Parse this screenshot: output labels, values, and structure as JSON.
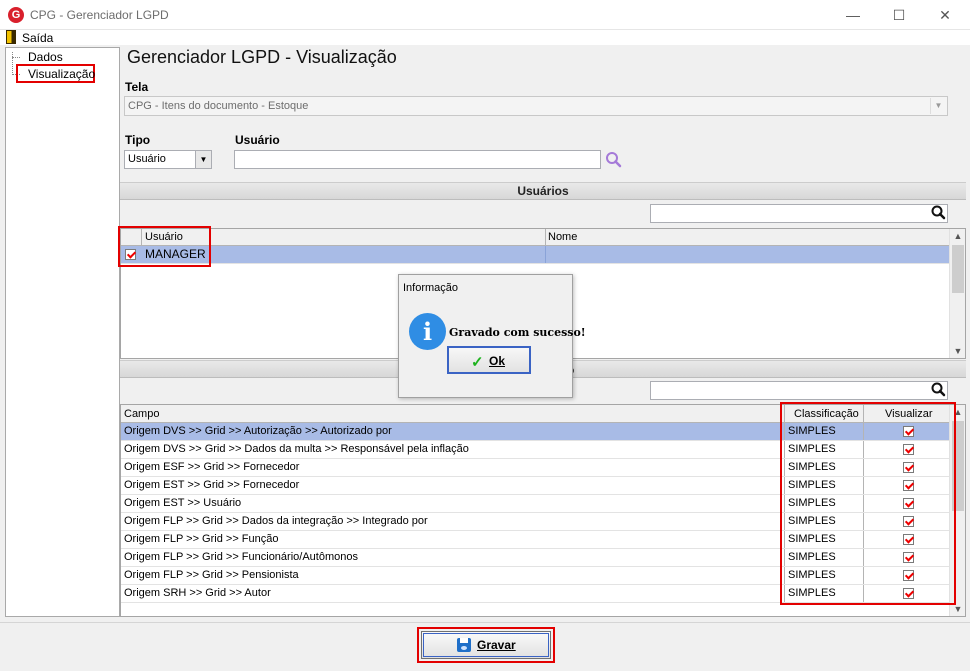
{
  "window": {
    "title": "CPG - Gerenciador LGPD",
    "logo_letter": "G",
    "minimize_glyph": "—",
    "maximize_glyph": "☐",
    "close_glyph": "✕"
  },
  "menu": {
    "exit_label": "Saída"
  },
  "tree": {
    "items": [
      {
        "label": "Dados"
      },
      {
        "label": "Visualização"
      }
    ]
  },
  "header": {
    "title": "Gerenciador LGPD - Visualização"
  },
  "form": {
    "screen_label": "Tela",
    "screen_value": "CPG - Itens do documento - Estoque",
    "type_label": "Tipo",
    "type_value": "Usuário",
    "user_label": "Usuário",
    "user_value": ""
  },
  "users_section": {
    "title": "Usuários",
    "search_value": "",
    "columns": [
      "Usuário",
      "Nome"
    ],
    "rows": [
      {
        "user": "MANAGER",
        "name": "",
        "checked": true
      }
    ]
  },
  "fields_section": {
    "title_suffix": "o",
    "search_value": "",
    "columns": [
      "Campo",
      "Classificação",
      "Visualizar"
    ],
    "rows": [
      {
        "field": "Origem DVS >> Grid >> Autorização >> Autorizado por",
        "classification": "SIMPLES",
        "visible": true
      },
      {
        "field": "Origem DVS >> Grid >> Dados da multa >> Responsável pela inflação",
        "classification": "SIMPLES",
        "visible": true
      },
      {
        "field": "Origem ESF >> Grid >> Fornecedor",
        "classification": "SIMPLES",
        "visible": true
      },
      {
        "field": "Origem EST >> Grid >> Fornecedor",
        "classification": "SIMPLES",
        "visible": true
      },
      {
        "field": "Origem EST >> Usuário",
        "classification": "SIMPLES",
        "visible": true
      },
      {
        "field": "Origem FLP >> Grid >> Dados da integração >> Integrado por",
        "classification": "SIMPLES",
        "visible": true
      },
      {
        "field": "Origem FLP >> Grid >> Função",
        "classification": "SIMPLES",
        "visible": true
      },
      {
        "field": "Origem FLP >> Grid >> Funcionário/Autômonos",
        "classification": "SIMPLES",
        "visible": true
      },
      {
        "field": "Origem FLP >> Grid >> Pensionista",
        "classification": "SIMPLES",
        "visible": true
      },
      {
        "field": "Origem SRH >> Grid >> Autor",
        "classification": "SIMPLES",
        "visible": true
      }
    ]
  },
  "dialog": {
    "title": "Informação",
    "icon": "info-icon",
    "icon_glyph": "i",
    "message": "Gravado com sucesso!",
    "ok_label": "Ok",
    "ok_glyph": "✓"
  },
  "footer": {
    "save_label": "Gravar",
    "save_icon": "floppy-disk-icon"
  },
  "colors": {
    "highlight": "#e30000",
    "selection": "#a8bbe6",
    "accent": "#3a63c4"
  }
}
